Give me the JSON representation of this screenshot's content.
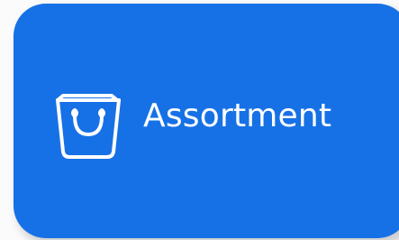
{
  "card": {
    "label": "Assortment",
    "icon": "shopping-bag-icon",
    "background_color": "#1771e6",
    "text_color": "#ffffff"
  }
}
